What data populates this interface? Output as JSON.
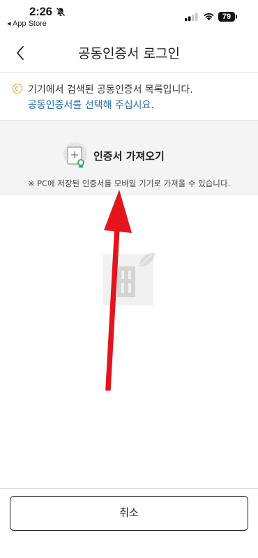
{
  "status_bar": {
    "time": "2:26",
    "back_app_label": "◂ App Store",
    "battery_level": "79"
  },
  "nav": {
    "title": "공동인증서 로그인"
  },
  "notice": {
    "line1": "기기에서 검색된 공동인증서 목록입니다.",
    "line2": "공동인증서를 선택해 주십시요."
  },
  "import": {
    "label": "인증서 가져오기",
    "description": "※ PC에 저장된 인증서를 모바일 기기로 가져올 수 있습니다."
  },
  "footer": {
    "cancel_label": "취소"
  },
  "icons": {
    "back": "chevron-left-icon",
    "notice": "info-circle-icon",
    "certificate": "certificate-add-icon",
    "annotation": "red-arrow-annotation"
  },
  "colors": {
    "link": "#2a6cb0",
    "notice_accent": "#e0a600",
    "annotation": "#e3141c"
  }
}
